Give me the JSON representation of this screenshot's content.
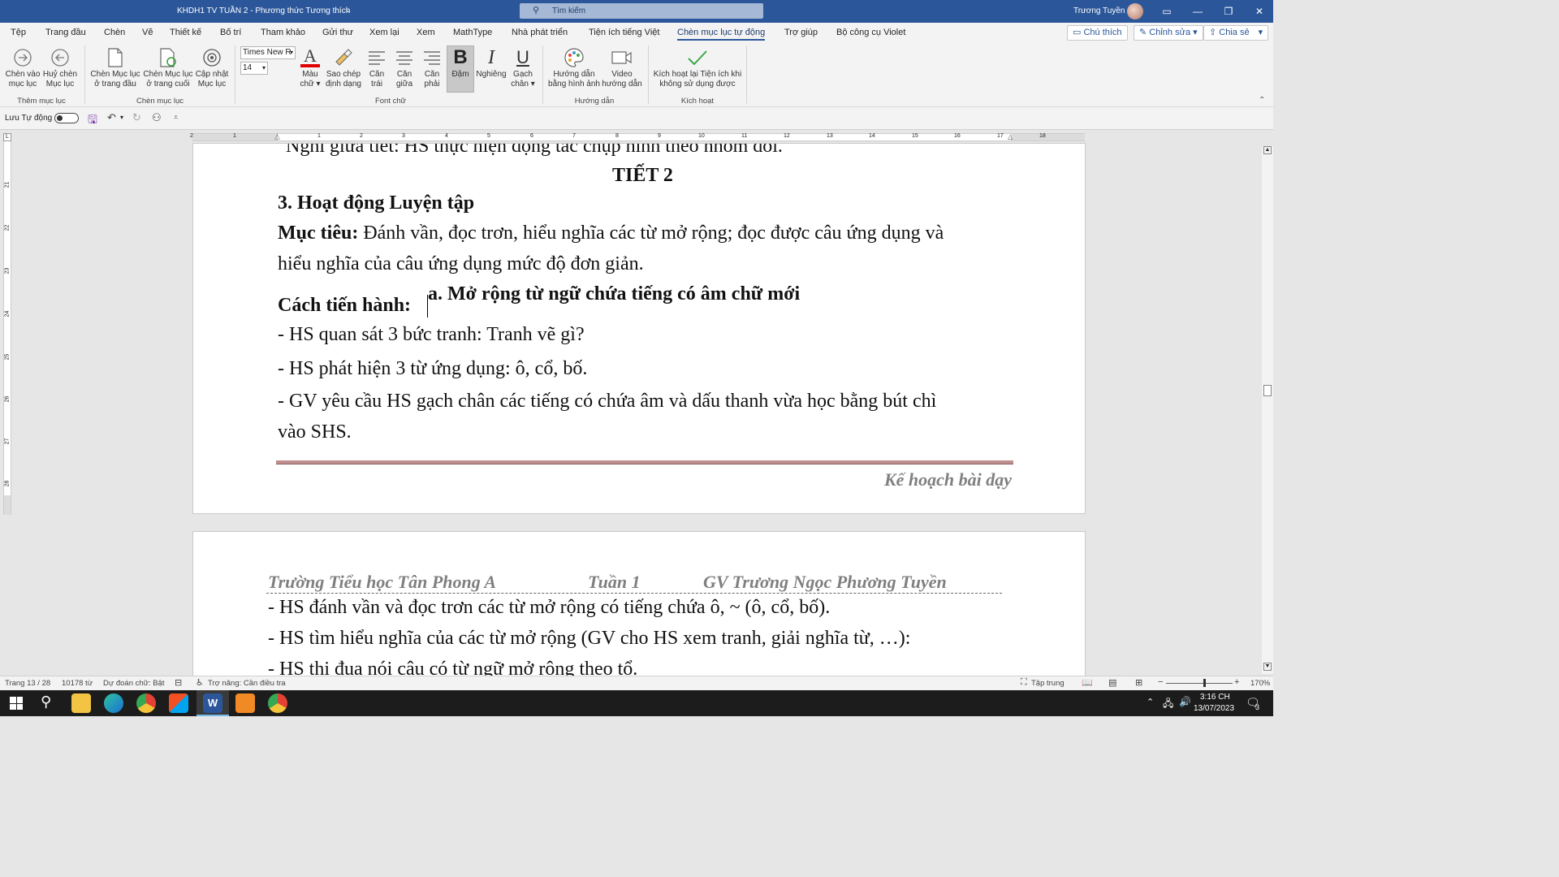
{
  "window": {
    "title": "KHDH1 TV TUẦN 2  -  Phương thức Tương thích",
    "search_placeholder": "Tìm kiếm",
    "user": "Trương Tuyền"
  },
  "menu": {
    "tabs": [
      "Tệp",
      "Trang đầu",
      "Chèn",
      "Vẽ",
      "Thiết kế",
      "Bố trí",
      "Tham khảo",
      "Gửi thư",
      "Xem lại",
      "Xem",
      "MathType",
      "Nhà phát triển",
      "Tiện ích tiếng Việt",
      "Chèn mục lục tự động",
      "Trợ giúp",
      "Bộ công cụ Violet"
    ],
    "active_tab": "Chèn mục lục tự động",
    "comment_btn": "Chú thích",
    "edit_btn": "Chỉnh sửa",
    "share_btn": "Chia sẻ"
  },
  "ribbon": {
    "btn_insert_toc": [
      "Chèn vào",
      "mục lục"
    ],
    "btn_cancel_toc": [
      "Huỷ chèn",
      "Mục lục"
    ],
    "group_add_toc": "Thêm mục lục",
    "btn_toc_top": [
      "Chèn Mục lục",
      "ở trang đầu"
    ],
    "btn_toc_end": [
      "Chèn Mục lục",
      "ở trang cuối"
    ],
    "btn_update_toc": [
      "Cập nhật",
      "Mục lục"
    ],
    "group_insert_toc": "Chèn mục lục",
    "font_name": "Times New R",
    "font_size": "14",
    "btn_font_color": [
      "Màu",
      "chữ"
    ],
    "btn_copy_format": [
      "Sao chép",
      "định dạng"
    ],
    "btn_align_left": [
      "Căn",
      "trái"
    ],
    "btn_align_center": [
      "Căn",
      "giữa"
    ],
    "btn_align_right": [
      "Căn",
      "phải"
    ],
    "btn_bold": "Đậm",
    "btn_italic": "Nghiêng",
    "btn_underline": [
      "Gạch",
      "chân"
    ],
    "group_font": "Font chữ",
    "btn_guide_image": [
      "Hướng dẫn",
      "bằng hình ảnh"
    ],
    "btn_guide_video": [
      "Video",
      "hướng dẫn"
    ],
    "group_guide": "Hướng dẫn",
    "btn_activate": [
      "Kích hoạt lại Tiện ích khi",
      "không sử dụng được"
    ],
    "group_activate": "Kích hoạt"
  },
  "qat": {
    "autosave_label": "Lưu Tự động"
  },
  "ruler": {
    "h_labels": [
      "2",
      "1",
      "1",
      "2",
      "3",
      "4",
      "5",
      "6",
      "7",
      "8",
      "9",
      "10",
      "11",
      "12",
      "13",
      "14",
      "15",
      "16",
      "17",
      "18"
    ],
    "v_labels": [
      "21",
      "22",
      "23",
      "24",
      "25",
      "26",
      "27",
      "28"
    ]
  },
  "page1": {
    "partial_top": "Nghỉ giữa tiết: HS thực hiện động tác chụp hình theo nhóm đôi.",
    "tiet": "TIẾT 2",
    "heading": "3. Hoạt động Luyện tập",
    "muctieu_label": "Mục tiêu:",
    "muctieu_text1": " Đánh vần, đọc trơn, hiểu nghĩa các từ mở rộng; đọc được câu ứng dụng và",
    "muctieu_text2": "hiểu nghĩa của câu ứng dụng mức độ đơn giản.",
    "cach_label": "Cách tiến hành:",
    "sub_heading": "a. Mở rộng từ ngữ chứa tiếng có âm chữ mới",
    "line1": "- HS quan sát 3 bức tranh: Tranh vẽ gì?",
    "line2": "- HS phát hiện 3 từ ứng dụng: ô, cổ, bố.",
    "line3a": "- GV yêu cầu HS gạch chân các tiếng có chứa âm và dấu thanh vừa học bằng bút chì",
    "line3b": "vào SHS.",
    "footer": "Kế hoạch bài dạy"
  },
  "page2": {
    "header_school": "Trường Tiểu học Tân Phong A",
    "header_week": "Tuần 1",
    "header_teacher": "GV Trương Ngọc Phương Tuyền",
    "line1": "- HS đánh vần và đọc trơn các từ mở rộng có tiếng chứa ô, ~ (ô, cổ, bố).",
    "line2": "- HS tìm hiểu nghĩa của các từ mở rộng (GV cho HS xem tranh, giải nghĩa từ, …):",
    "line3": "- HS thi đua nói câu có từ ngữ mở rộng theo tổ."
  },
  "status": {
    "page": "Trang 13 / 28",
    "words": "10178 từ",
    "predict": "Dự đoán chữ: Bật",
    "accessibility": "Trợ năng: Cần điều tra",
    "focus": "Tập trung",
    "zoom": "170%"
  },
  "taskbar": {
    "time": "3:16 CH",
    "date": "13/07/2023",
    "notif": "3"
  },
  "colors": {
    "titlebar": "#2b579a",
    "font_color_bar": "#e00000",
    "footer_rule": "#c09090"
  }
}
